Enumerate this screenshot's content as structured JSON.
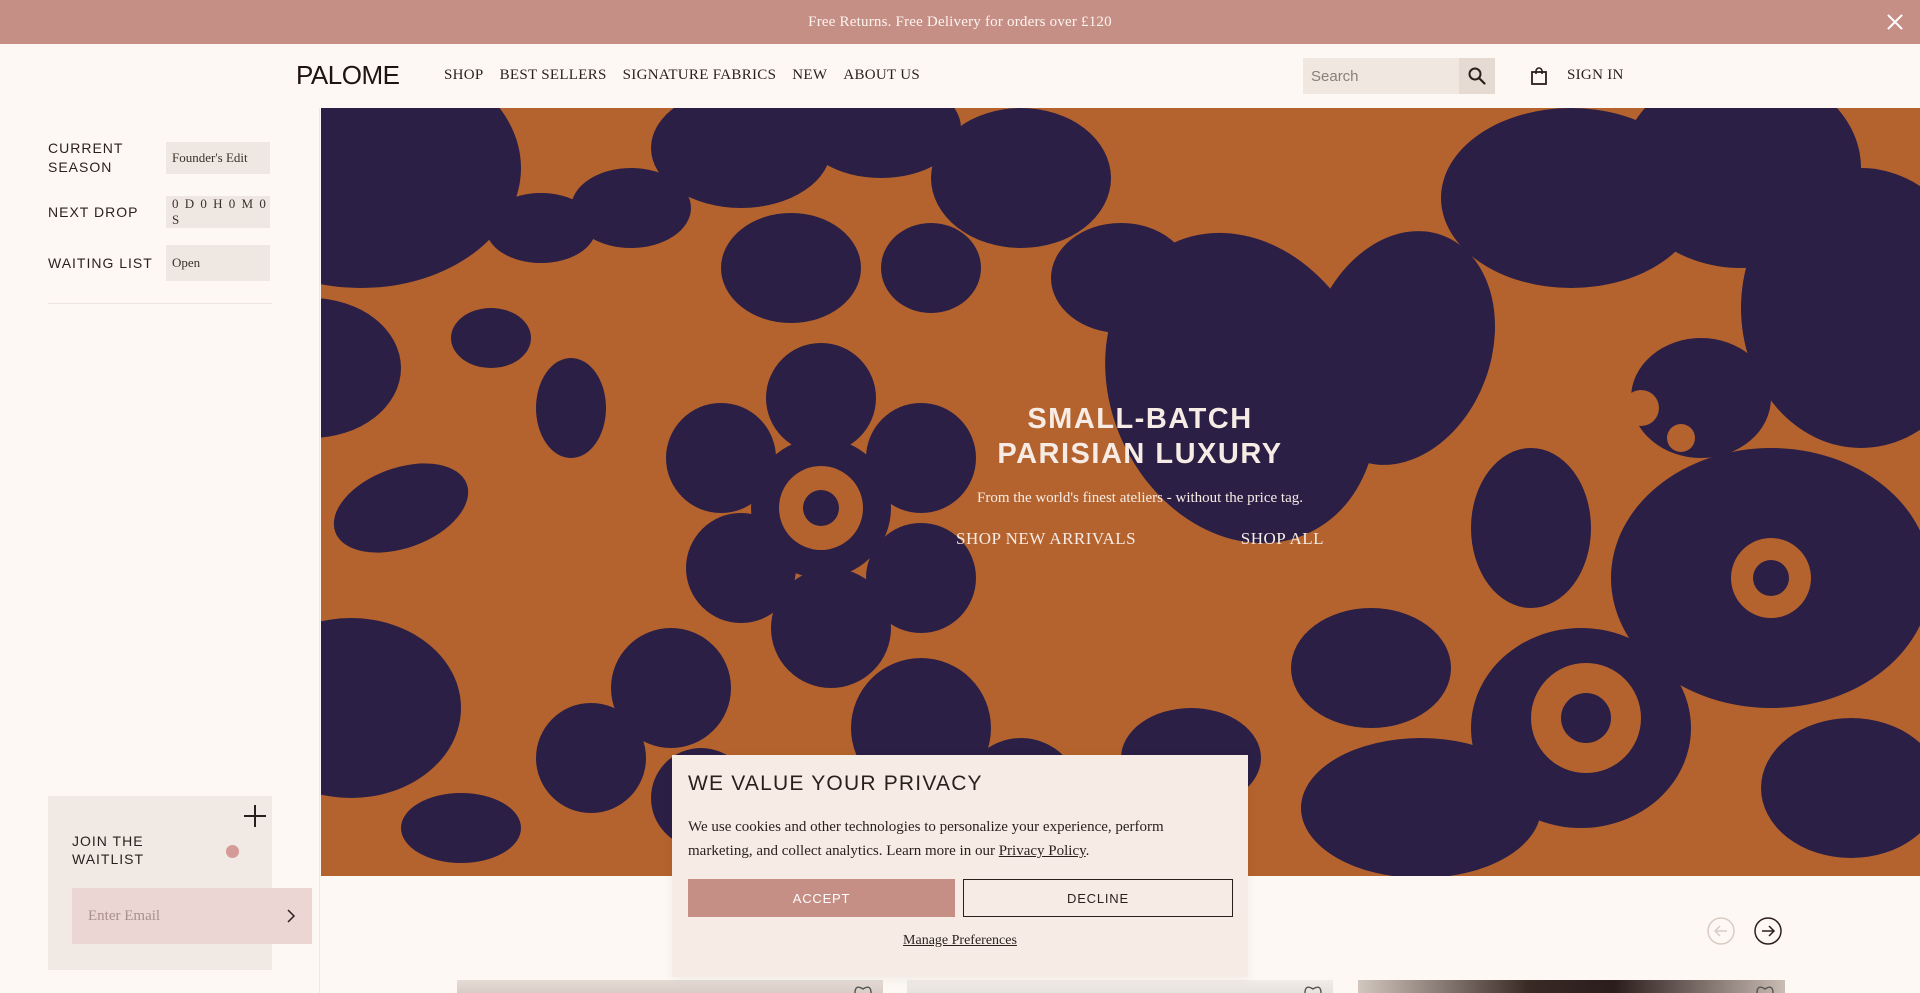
{
  "announcement": {
    "text": "Free Returns. Free Delivery for orders over £120"
  },
  "header": {
    "logo": "PALOME",
    "nav": [
      "SHOP",
      "BEST SELLERS",
      "SIGNATURE FABRICS",
      "NEW",
      "ABOUT US"
    ],
    "search_placeholder": "Search",
    "signin": "SIGN IN"
  },
  "sidebar": {
    "rows": [
      {
        "label": "CURRENT SEASON",
        "value": "Founder's Edit"
      },
      {
        "label": "NEXT DROP",
        "value": "0 D 0 H 0 M 0 S"
      },
      {
        "label": "WAITING LIST",
        "value": "Open"
      }
    ],
    "waitlist": {
      "title": "JOIN THE WAITLIST",
      "email_placeholder": "Enter Email"
    }
  },
  "hero": {
    "title": "SMALL-BATCH PARISIAN LUXURY",
    "subtitle": "From the world's finest ateliers - without the price tag.",
    "cta_primary": "SHOP NEW ARRIVALS",
    "cta_secondary": "SHOP ALL"
  },
  "cookie": {
    "title": "WE VALUE YOUR PRIVACY",
    "body": "We use cookies and other technologies to personalize your experience, perform marketing, and collect analytics. Learn more in our ",
    "link": "Privacy Policy",
    "accept": "ACCEPT",
    "decline": "DECLINE",
    "manage": "Manage Preferences"
  },
  "colors": {
    "accent": "#c68f86",
    "background": "#fdf8f3",
    "fabric_orange": "#b5632e",
    "fabric_navy": "#2b1f45"
  },
  "icons": [
    "close-icon",
    "search-icon",
    "bag-icon",
    "plus-icon",
    "chevron-right-icon",
    "arrow-left-icon",
    "arrow-right-icon",
    "heart-icon"
  ]
}
